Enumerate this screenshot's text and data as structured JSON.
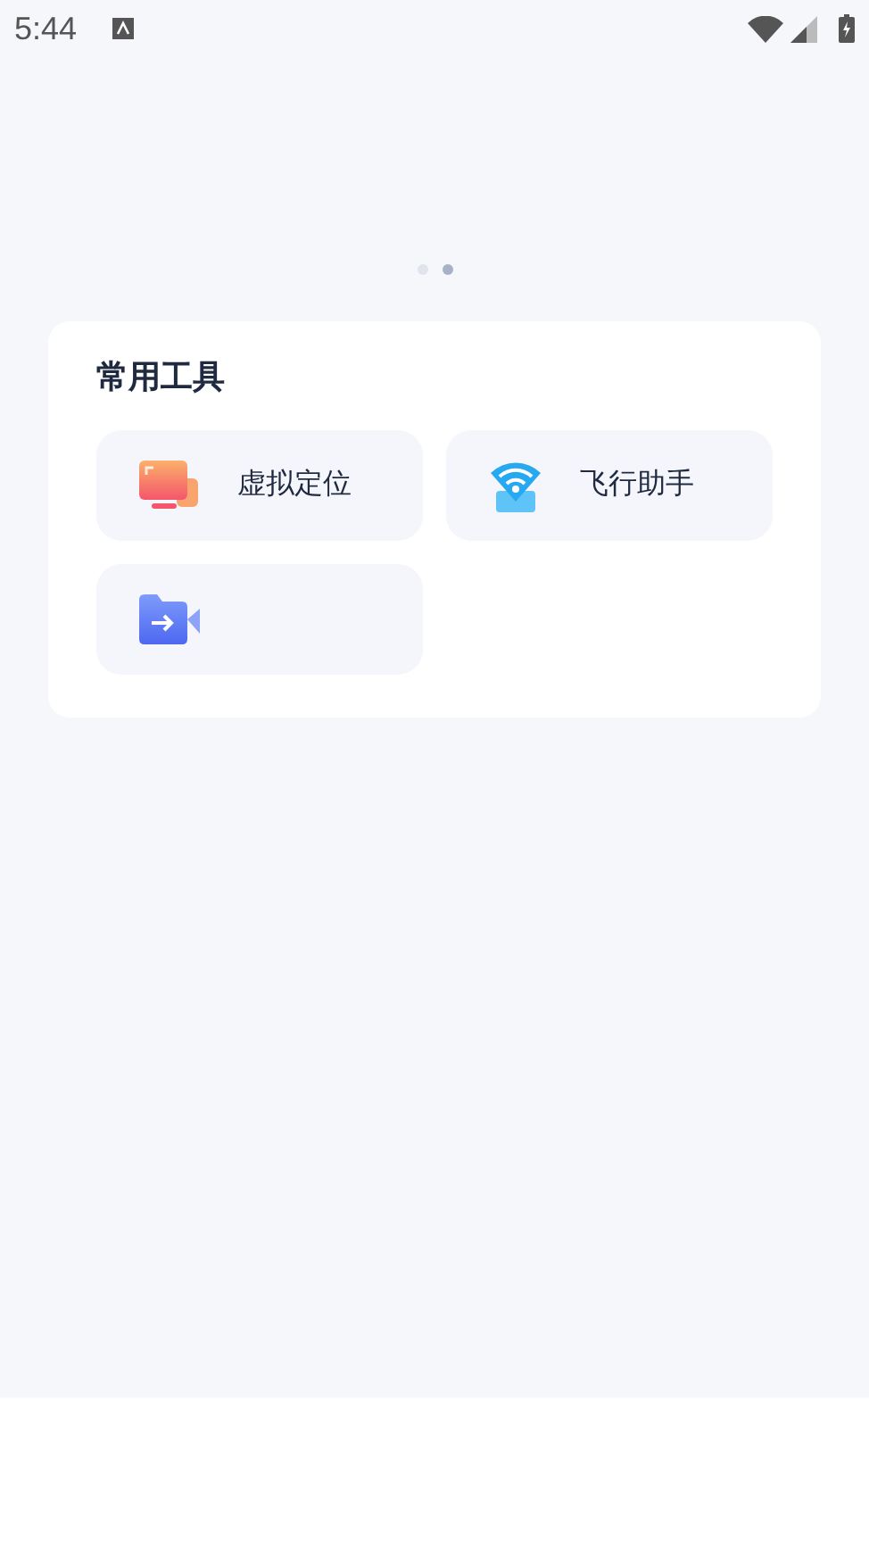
{
  "status_bar": {
    "time": "5:44"
  },
  "pager": [
    {
      "selected": false
    },
    {
      "selected": true
    }
  ],
  "tools_card": {
    "title": "常用工具",
    "tools": [
      {
        "kind": "screen",
        "label": "虚拟定位"
      },
      {
        "kind": "wifi",
        "label": "飞行助手"
      },
      {
        "kind": "video"
      }
    ]
  }
}
